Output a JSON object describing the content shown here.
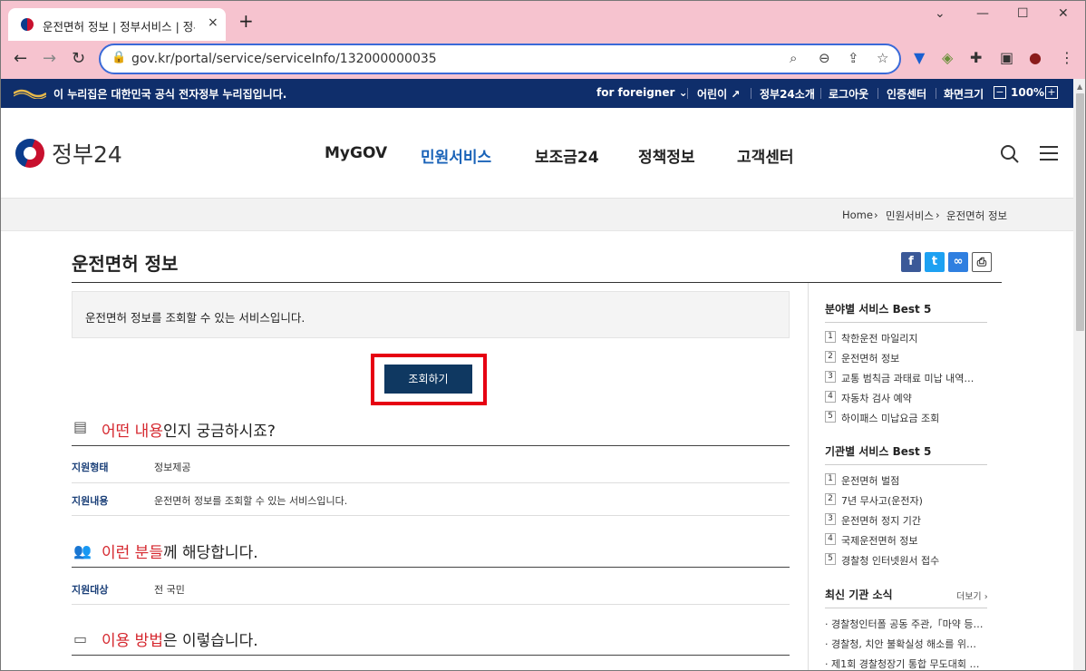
{
  "browser": {
    "tab_title": "운전면허 정보 | 정부서비스 | 정부",
    "new_tab": "+",
    "close_tab": "×",
    "window_controls": [
      "⌄",
      "—",
      "☐",
      "✕"
    ],
    "url": "gov.kr/portal/service/serviceInfo/132000000035"
  },
  "govbar": {
    "notice": "이 누리집은 대한민국 공식 전자정부 누리집입니다.",
    "for_foreigner": "for foreigner",
    "kids": "어린이",
    "about": "정부24소개",
    "logout": "로그아웃",
    "cert": "인증센터",
    "screen_size": "화면크기",
    "zoom": "100%"
  },
  "header": {
    "brand": "정부24",
    "menu": [
      "MyGOV",
      "민원서비스",
      "보조금24",
      "정책정보",
      "고객센터"
    ]
  },
  "breadcrumb": [
    "Home",
    "민원서비스",
    "운전면허 정보"
  ],
  "page": {
    "title": "운전면허 정보",
    "summary": "운전면허 정보를 조회할 수 있는 서비스입니다.",
    "query_button": "조회하기",
    "section1": {
      "highlight": "어떤 내용",
      "rest": "인지 궁금하시죠?"
    },
    "rows1": [
      {
        "key": "지원형태",
        "value": "정보제공"
      },
      {
        "key": "지원내용",
        "value": "운전면허 정보를 조회할 수 있는 서비스입니다."
      }
    ],
    "section2": {
      "highlight": "이런 분들",
      "rest": "께 해당합니다."
    },
    "rows2": [
      {
        "key": "지원대상",
        "value": "전 국민"
      }
    ],
    "section3": {
      "highlight": "이용 방법",
      "rest": "은 이렇습니다."
    }
  },
  "sidebar": {
    "field_best_title": "분야별 서비스 Best 5",
    "field_best": [
      "착한운전 마일리지",
      "운전면허 정보",
      "교통 범칙금 과태료 미납 내역…",
      "자동차 검사 예약",
      "하이패스 미납요금 조회"
    ],
    "agency_best_title": "기관별 서비스 Best 5",
    "agency_best": [
      "운전면허 벌점",
      "7년 무사고(운전자)",
      "운전면허 정지 기간",
      "국제운전면허 정보",
      "경찰청 인터넷원서 접수"
    ],
    "news_title": "최신 기관 소식",
    "news_more": "더보기 ›",
    "news": [
      "· 경찰청인터폴 공동 주관,「마약 등…",
      "· 경찰청, 치안 불확실성 해소를 위…",
      "· 제1회 경찰청장기 통합 무도대회 …"
    ]
  }
}
